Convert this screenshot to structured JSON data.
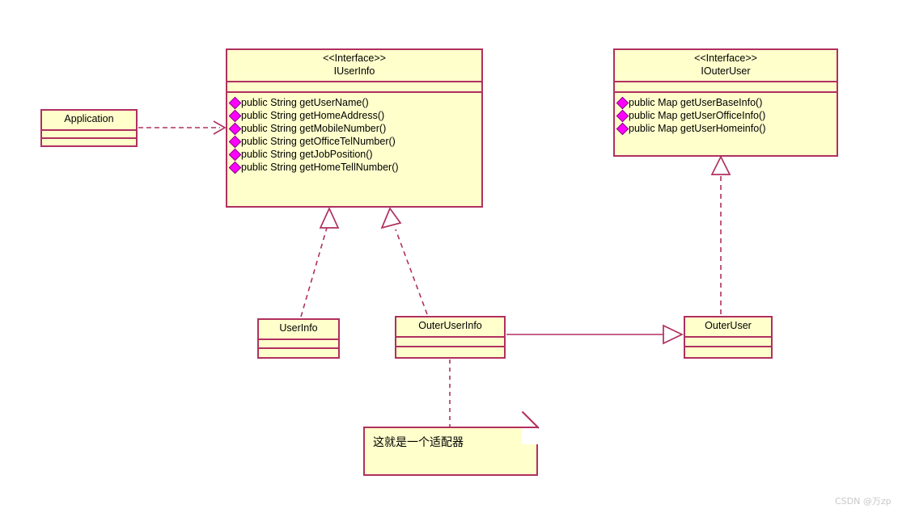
{
  "diagram": {
    "type": "uml-class-diagram",
    "background": "#ffffff",
    "class_fill": "#ffffcc",
    "class_stroke": "#b03060",
    "marker_color": "#ff00ff",
    "text_color": "#000000"
  },
  "classes": {
    "application": {
      "name": "Application",
      "stereotype": "",
      "operations": []
    },
    "iuserinfo": {
      "stereotype": "<<Interface>>",
      "name": "IUserInfo",
      "operations": [
        "public String getUserName()",
        "public String getHomeAddress()",
        "public String getMobileNumber()",
        "public String getOfficeTelNumber()",
        "public String getJobPosition()",
        "public String getHomeTellNumber()"
      ]
    },
    "iouteruser": {
      "stereotype": "<<Interface>>",
      "name": "IOuterUser",
      "operations": [
        "public Map getUserBaseInfo()",
        "public Map getUserOfficeInfo()",
        "public Map getUserHomeinfo()"
      ]
    },
    "userinfo": {
      "name": "UserInfo",
      "stereotype": "",
      "operations": []
    },
    "outeruserinfo": {
      "name": "OuterUserInfo",
      "stereotype": "",
      "operations": []
    },
    "outeruser": {
      "name": "OuterUser",
      "stereotype": "",
      "operations": []
    }
  },
  "note": {
    "text": "这就是一个适配器"
  },
  "relations": [
    {
      "name": "application-uses-iuserinfo",
      "from": "application",
      "to": "iuserinfo",
      "style": "dashed",
      "arrow": "open"
    },
    {
      "name": "userinfo-realizes-iuserinfo",
      "from": "userinfo",
      "to": "iuserinfo",
      "style": "dashed",
      "arrow": "hollow-triangle"
    },
    {
      "name": "outeruserinfo-realizes-iuserinfo",
      "from": "outeruserinfo",
      "to": "iuserinfo",
      "style": "dashed",
      "arrow": "hollow-triangle"
    },
    {
      "name": "outeruser-realizes-iouteruser",
      "from": "outeruser",
      "to": "iouteruser",
      "style": "dashed",
      "arrow": "hollow-triangle"
    },
    {
      "name": "outeruserinfo-to-outeruser",
      "from": "outeruserinfo",
      "to": "outeruser",
      "style": "solid",
      "arrow": "hollow-triangle"
    },
    {
      "name": "note-anchor-outeruserinfo",
      "from": "note",
      "to": "outeruserinfo",
      "style": "dashed",
      "arrow": "none"
    }
  ],
  "watermark": {
    "text": "CSDN @万zp"
  }
}
